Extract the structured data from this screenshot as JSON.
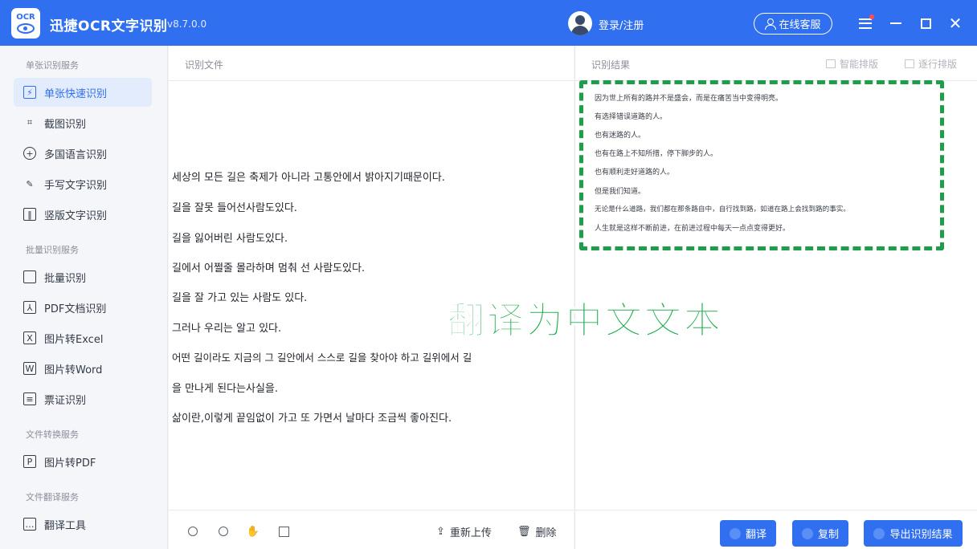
{
  "app": {
    "title": "迅捷OCR文字识别",
    "version": "v8.7.0.0",
    "login_label": "登录/注册",
    "service_label": "在线客服"
  },
  "sidebar": {
    "sections": [
      {
        "label": "单张识别服务"
      },
      {
        "label": "批量识别服务"
      },
      {
        "label": "文件转换服务"
      },
      {
        "label": "文件翻译服务"
      }
    ],
    "items": [
      {
        "label": "单张快速识别",
        "icon": "lightning-doc-icon",
        "active": true
      },
      {
        "label": "截图识别",
        "icon": "crop-icon"
      },
      {
        "label": "多国语言识别",
        "icon": "globe-icon"
      },
      {
        "label": "手写文字识别",
        "icon": "pen-icon"
      },
      {
        "label": "竖版文字识别",
        "icon": "vertical-text-icon"
      },
      {
        "label": "批量识别",
        "icon": "stack-icon"
      },
      {
        "label": "PDF文档识别",
        "icon": "pdf-icon"
      },
      {
        "label": "图片转Excel",
        "icon": "excel-icon"
      },
      {
        "label": "图片转Word",
        "icon": "word-icon"
      },
      {
        "label": "票证识别",
        "icon": "ticket-icon"
      },
      {
        "label": "图片转PDF",
        "icon": "pdf-file-icon"
      },
      {
        "label": "翻译工具",
        "icon": "translate-icon"
      }
    ]
  },
  "left_pane": {
    "title": "识别文件",
    "lines": [
      "세상의 모든 길은 축제가 아니라 고통안에서 밝아지기때문이다.",
      "길을 잘못 들어선사람도있다.",
      "길을 잃어버린 사람도있다.",
      "길에서 어쩔줄 몰라하며 멈춰 선 사람도있다.",
      "길을 잘 가고 있는 사람도 있다.",
      "그러나 우리는 알고 있다.",
      "어떤 길이라도 지금의 그 길안에서 스스로 길을 찾아야 하고 길위에서 길",
      "을 만나게 된다는사실을.",
      "삶이란,이렇게 끝임없이 가고 또 가면서 날마다 조금씩 좋아진다."
    ],
    "reupload_label": "重新上传",
    "delete_label": "删除"
  },
  "right_pane": {
    "title": "识别结果",
    "smart_typeset_label": "智能排版",
    "line_typeset_label": "逐行排版",
    "lines": [
      "因为世上所有的路并不是盛会，而是在痛苦当中变得明亮。",
      "有选择错误道路的人。",
      "也有迷路的人。",
      "也有在路上不知所措，停下脚步的人。",
      "也有顺利走好道路的人。",
      "但是我们知道。",
      "无论是什么道路，我们都在那条路自中，自行找到路，如道在路上会找到路的事实。",
      "人生就是这样不断前进，在前进过程中每天一点点变得更好。"
    ],
    "translate_label": "翻译",
    "copy_label": "复制",
    "export_label": "导出识别结果"
  },
  "overlay": {
    "caption": "翻译为中文文本"
  },
  "colors": {
    "brand": "#2f6ff0",
    "highlight": "#1e9e4a"
  }
}
